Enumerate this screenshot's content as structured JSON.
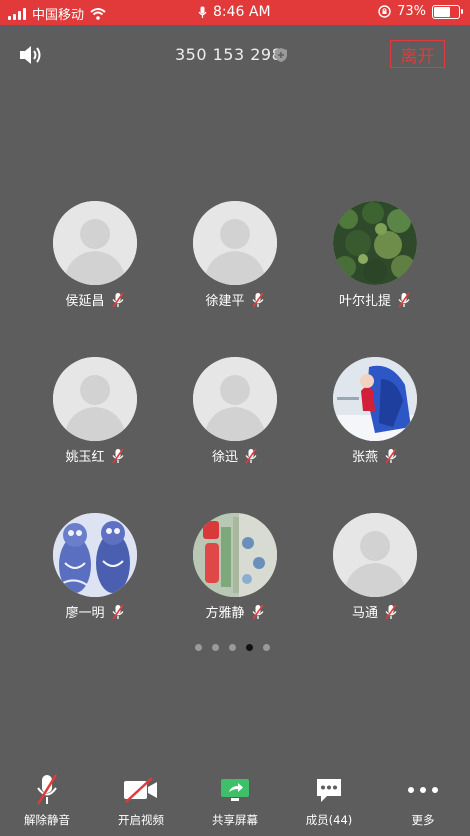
{
  "status_bar": {
    "carrier": "中国移动",
    "time": "8:46 AM",
    "battery": "73%",
    "battery_level": 0.73,
    "colors": {
      "bar": "#e23a3a"
    }
  },
  "header": {
    "meeting_id": "350 153 298",
    "leave_label": "离开"
  },
  "participants": [
    {
      "name": "侯延昌",
      "avatar": "placeholder",
      "muted": true
    },
    {
      "name": "徐建平",
      "avatar": "placeholder",
      "muted": true
    },
    {
      "name": "叶尔扎提",
      "avatar": "forest-photo",
      "muted": true
    },
    {
      "name": "姚玉红",
      "avatar": "placeholder",
      "muted": true
    },
    {
      "name": "徐迅",
      "avatar": "placeholder",
      "muted": true
    },
    {
      "name": "张燕",
      "avatar": "snow-person-photo",
      "muted": true
    },
    {
      "name": "廖一明",
      "avatar": "blue-figurines-photo",
      "muted": true
    },
    {
      "name": "方雅静",
      "avatar": "ornaments-photo",
      "muted": true
    },
    {
      "name": "马通",
      "avatar": "placeholder",
      "muted": true
    }
  ],
  "pagination": {
    "pages": 5,
    "current": 4
  },
  "toolbar": {
    "unmute_label": "解除静音",
    "video_label": "开启视频",
    "share_label": "共享屏幕",
    "members_label": "成员(44)",
    "more_label": "更多"
  },
  "icons": {
    "speaker": "speaker-icon",
    "shield": "shield-icon",
    "mic_muted": "mic-muted-icon",
    "video_off": "video-off-icon",
    "share": "share-screen-icon",
    "members": "chat-bubble-icon",
    "more": "more-icon"
  },
  "accent": "#e23a3a"
}
